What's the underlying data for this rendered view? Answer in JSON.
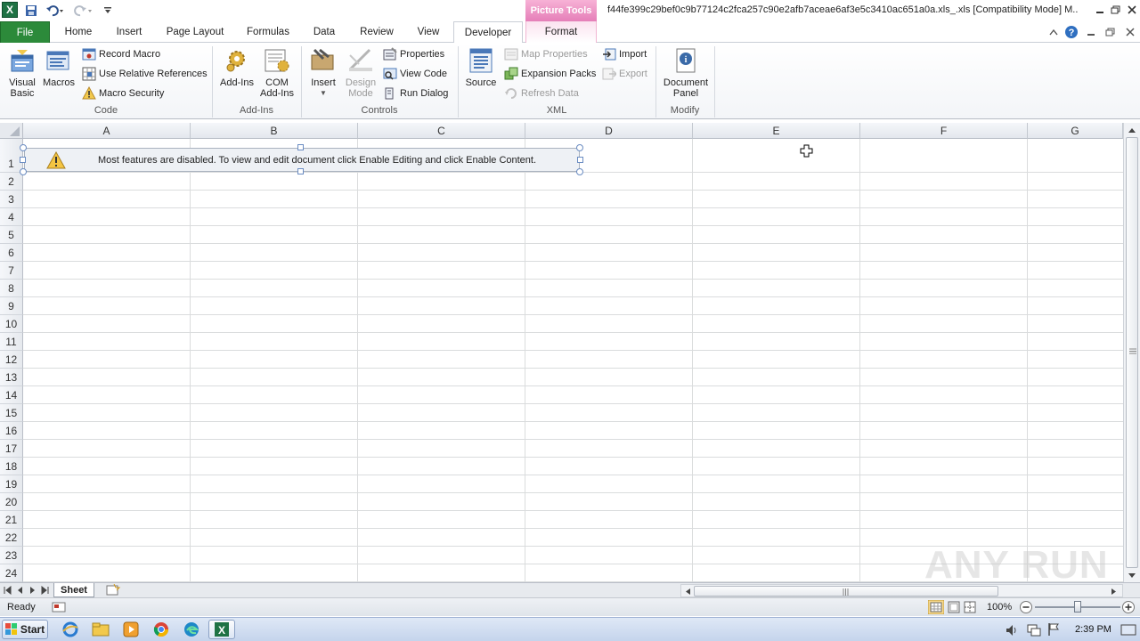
{
  "titlebar": {
    "picture_tools": "Picture Tools",
    "doc_title": "f44fe399c29bef0c9b77124c2fca257c90e2afb7aceae6af3e5c3410ac651a0a.xls_.xls  [Compatibility Mode]  M..",
    "excel_logo": "X"
  },
  "tabs": [
    "File",
    "Home",
    "Insert",
    "Page Layout",
    "Formulas",
    "Data",
    "Review",
    "View",
    "Developer",
    "Format"
  ],
  "ribbon": {
    "code": {
      "label": "Code",
      "visual_basic": "Visual\nBasic",
      "macros": "Macros",
      "record_macro": "Record Macro",
      "use_relative": "Use Relative References",
      "macro_security": "Macro Security"
    },
    "addins": {
      "label": "Add-Ins",
      "add_ins": "Add-Ins",
      "com_add_ins": "COM\nAdd-Ins"
    },
    "controls": {
      "label": "Controls",
      "insert": "Insert",
      "design_mode": "Design\nMode",
      "properties": "Properties",
      "view_code": "View Code",
      "run_dialog": "Run Dialog"
    },
    "xml": {
      "label": "XML",
      "source": "Source",
      "map_properties": "Map Properties",
      "expansion_packs": "Expansion Packs",
      "refresh_data": "Refresh Data",
      "import": "Import",
      "export": "Export"
    },
    "modify": {
      "label": "Modify",
      "document_panel": "Document\nPanel"
    }
  },
  "grid": {
    "columns": [
      "A",
      "B",
      "C",
      "D",
      "E",
      "F",
      "G"
    ],
    "rows": [
      "1",
      "2",
      "3",
      "4",
      "5",
      "6",
      "7",
      "8",
      "9",
      "10",
      "11",
      "12",
      "13",
      "14",
      "15",
      "16",
      "17",
      "18",
      "19",
      "20",
      "21",
      "22",
      "23",
      "24"
    ]
  },
  "banner": {
    "text": "Most features are disabled. To view and edit document click Enable Editing and click Enable Content."
  },
  "sheets": {
    "active": "Sheet"
  },
  "status": {
    "ready": "Ready",
    "zoom": "100%"
  },
  "taskbar": {
    "start": "Start",
    "clock": "2:39 PM"
  },
  "watermark": "ANY RUN",
  "colors": {
    "file_tab": "#2c8a3a",
    "picture_tools": "#e57fb8",
    "excel_green": "#1f7244"
  }
}
